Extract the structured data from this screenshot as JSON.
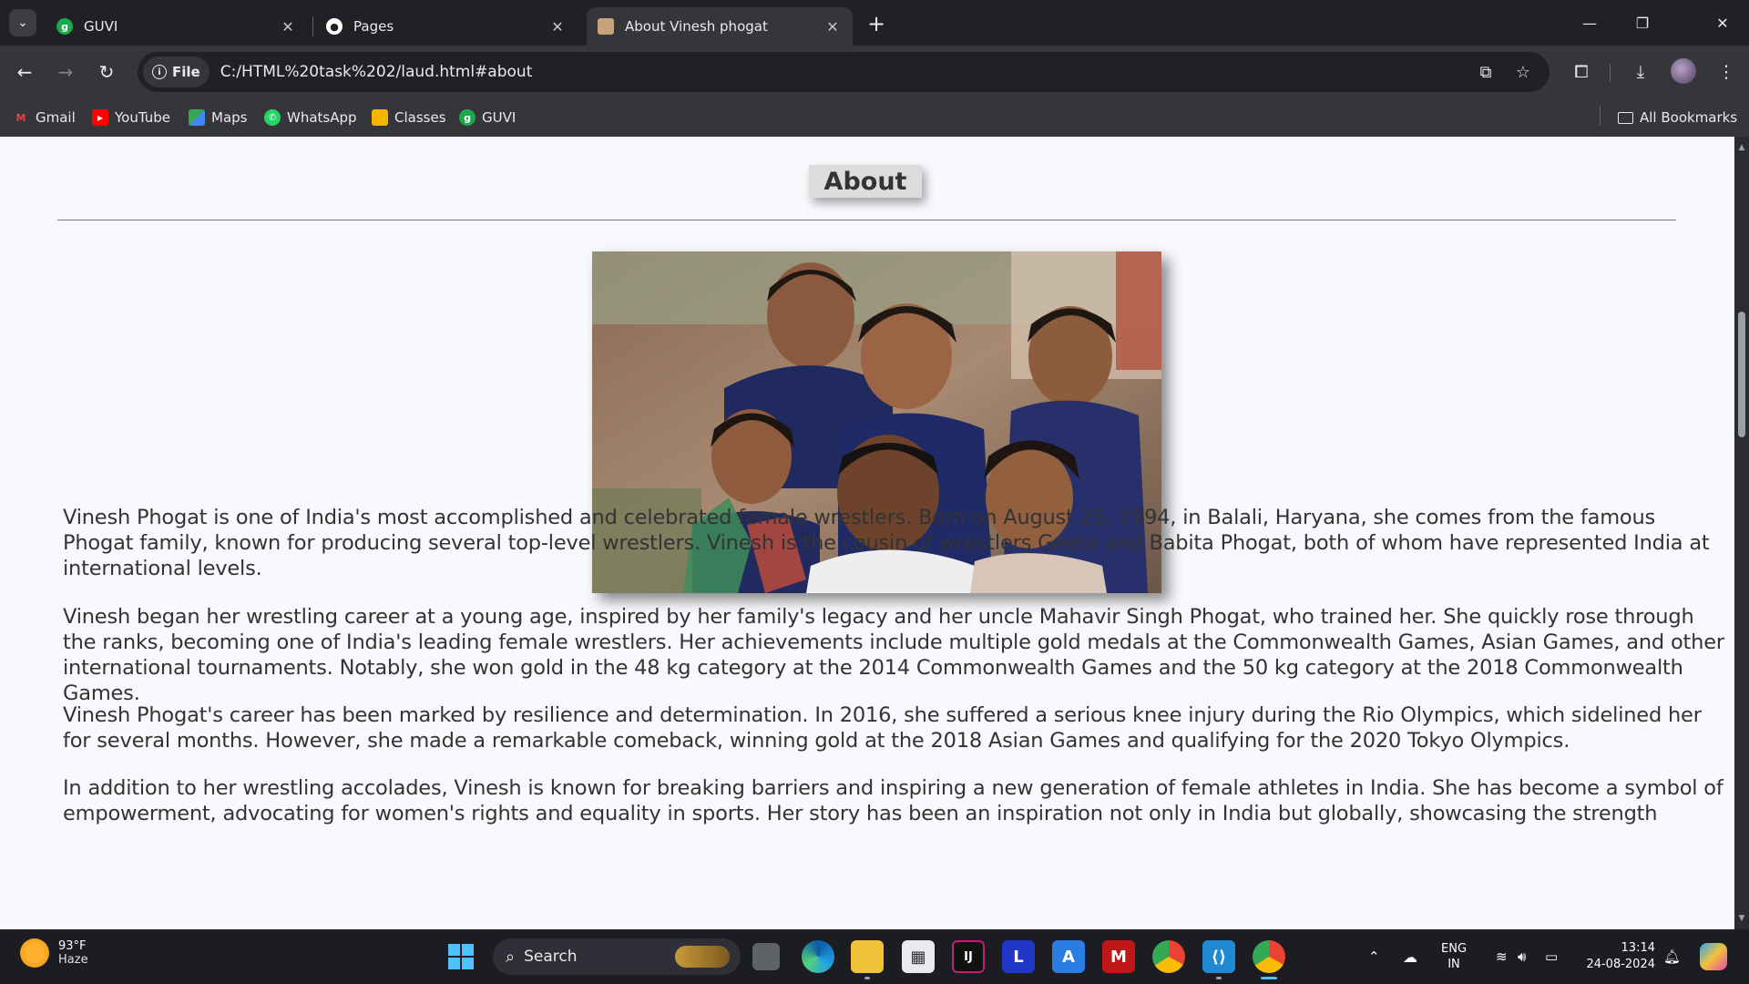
{
  "browser": {
    "tabs": [
      {
        "title": "GUVI",
        "favicon": "guvi-icon",
        "favicon_color": "#1ba94c",
        "active": false
      },
      {
        "title": "Pages",
        "favicon": "github-icon",
        "favicon_color": "#ffffff",
        "active": false
      },
      {
        "title": "About Vinesh phogat",
        "favicon": "photo-favicon-icon",
        "favicon_color": "#c7a27a",
        "active": true
      }
    ],
    "new_tab_label": "+",
    "address": {
      "chip_label": "File",
      "url": "C:/HTML%20task%202/laud.html#about"
    },
    "bookmarks": [
      {
        "label": "Gmail",
        "icon": "gmail-icon",
        "color": "#ea4335"
      },
      {
        "label": "YouTube",
        "icon": "youtube-icon",
        "color": "#ff0000"
      },
      {
        "label": "Maps",
        "icon": "maps-icon",
        "color": "#34a853"
      },
      {
        "label": "WhatsApp",
        "icon": "whatsapp-icon",
        "color": "#25d366"
      },
      {
        "label": "Classes",
        "icon": "classroom-icon",
        "color": "#f4b400"
      },
      {
        "label": "GUVI",
        "icon": "guvi-icon",
        "color": "#1ba94c"
      }
    ],
    "all_bookmarks_label": "All Bookmarks"
  },
  "page": {
    "heading": "About",
    "image_alt": "Vinesh Phogat with family",
    "paragraphs": [
      "Vinesh Phogat is one of India's most accomplished and celebrated female wrestlers. Born on August 25, 1994, in Balali, Haryana, she comes from the famous Phogat family, known for producing several top-level wrestlers. Vinesh is the cousin of wrestlers Geeta and Babita Phogat, both of whom have represented India at international levels.",
      "Vinesh began her wrestling career at a young age, inspired by her family's legacy and her uncle Mahavir Singh Phogat, who trained her. She quickly rose through the ranks, becoming one of India's leading female wrestlers. Her achievements include multiple gold medals at the Commonwealth Games, Asian Games, and other international tournaments. Notably, she won gold in the 48 kg category at the 2014 Commonwealth Games and the 50 kg category at the 2018 Commonwealth Games.",
      "Vinesh Phogat's career has been marked by resilience and determination. In 2016, she suffered a serious knee injury during the Rio Olympics, which sidelined her for several months. However, she made a remarkable comeback, winning gold at the 2018 Asian Games and qualifying for the 2020 Tokyo Olympics.",
      "In addition to her wrestling accolades, Vinesh is known for breaking barriers and inspiring a new generation of female athletes in India. She has become a symbol of empowerment, advocating for women's rights and equality in sports. Her story has been an inspiration not only in India but globally, showcasing the strength"
    ]
  },
  "taskbar": {
    "weather": {
      "temp": "93°F",
      "condition": "Haze"
    },
    "search_placeholder": "Search",
    "apps": [
      "windows-start-icon",
      "task-view-icon",
      "edge-icon",
      "file-explorer-icon",
      "store-icon",
      "intellij-icon",
      "l-app-icon",
      "autodesk-icon",
      "mcafee-icon",
      "chrome-icon",
      "vscode-icon",
      "chrome-active-icon"
    ],
    "language_line1": "ENG",
    "language_line2": "IN",
    "time": "13:14",
    "date": "24-08-2024"
  }
}
